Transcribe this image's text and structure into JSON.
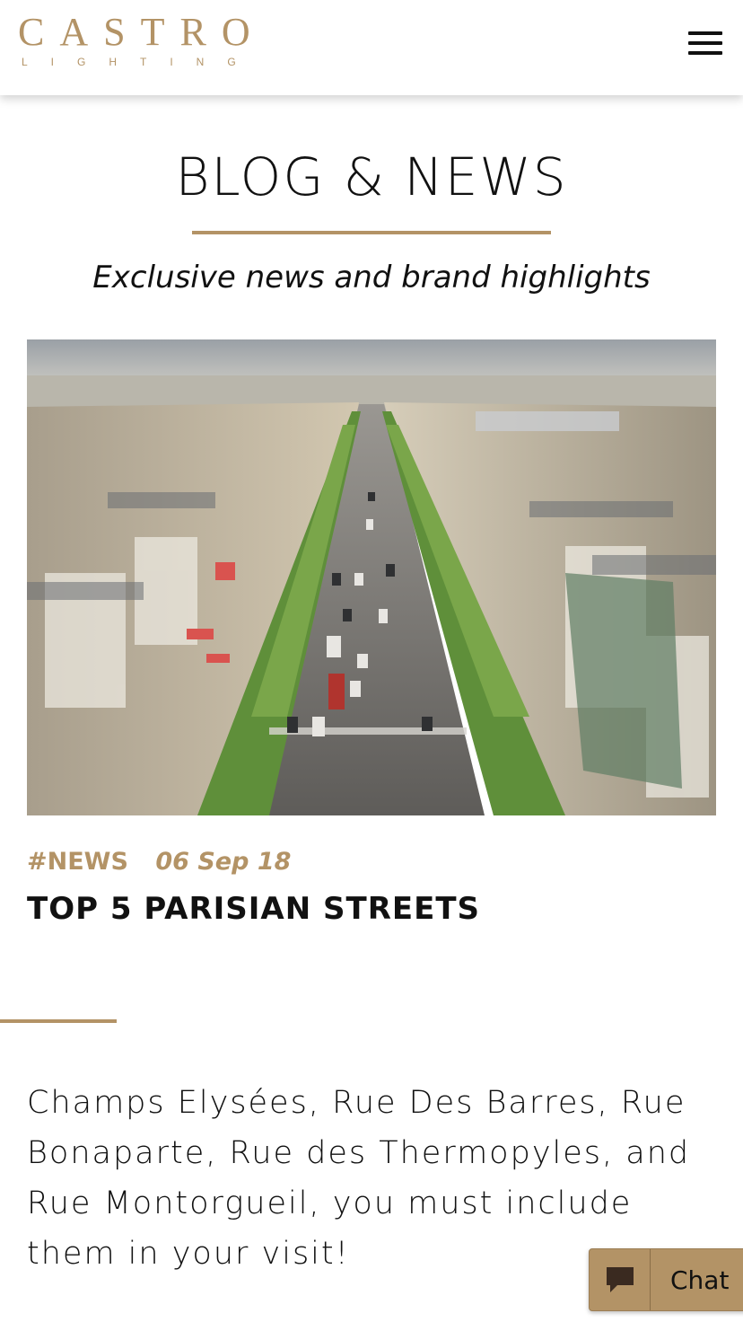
{
  "header": {
    "logo_main": "CASTRO",
    "logo_sub": "LIGHTING"
  },
  "page": {
    "title": "BLOG & NEWS",
    "subtitle": "Exclusive news and brand highlights"
  },
  "post": {
    "tag": "#NEWS",
    "date": "06 Sep 18",
    "title": "TOP 5 PARISIAN STREETS",
    "excerpt": "Champs Elysées, Rue Des Barres, Rue Bonaparte, Rue des Thermopyles, and Rue Montorgueil, you must include them in your visit!"
  },
  "chat": {
    "label": "Chat"
  },
  "colors": {
    "accent": "#b39366",
    "text": "#111111",
    "background": "#ffffff"
  },
  "icons": {
    "menu": "hamburger-menu-icon",
    "chat": "chat-bubble-icon"
  }
}
